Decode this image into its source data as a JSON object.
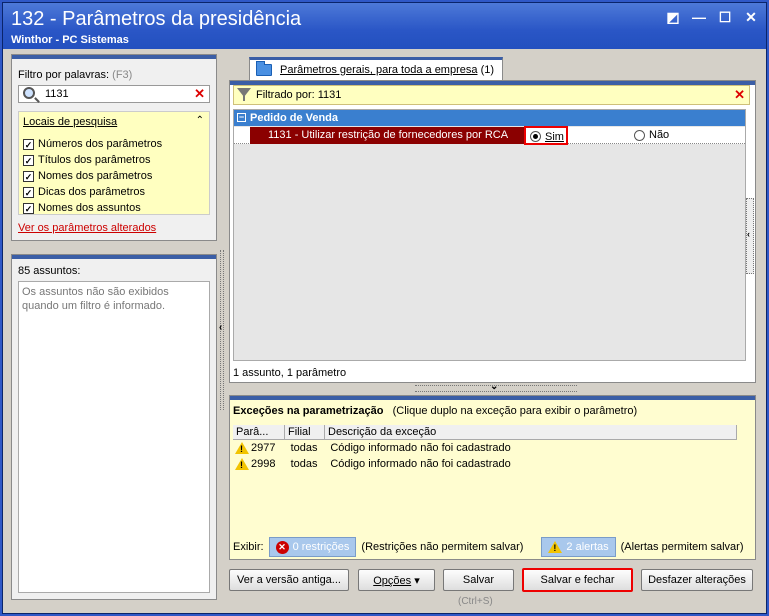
{
  "window": {
    "title": "132 - Parâmetros da presidência",
    "subtitle": "Winthor - PC Sistemas",
    "controls": [
      "◩",
      "—",
      "☐",
      "✕"
    ]
  },
  "filter": {
    "label": "Filtro por palavras:",
    "shortcut": "(F3)",
    "value": "1131",
    "clear": "✕",
    "locais_title": "Locais de pesquisa",
    "collapse_icon": "⌃",
    "options": [
      {
        "label": "Números dos parâmetros",
        "checked": true
      },
      {
        "label": "Títulos dos parâmetros",
        "checked": true
      },
      {
        "label": "Nomes dos parâmetros",
        "checked": true
      },
      {
        "label": "Dicas dos parâmetros",
        "checked": true
      },
      {
        "label": "Nomes dos assuntos",
        "checked": true
      }
    ],
    "altered_link": "Ver os parâmetros alterados"
  },
  "assuntos": {
    "count_label": "85 assuntos:",
    "message": "Os assuntos não são exibidos quando um filtro é informado."
  },
  "tab": {
    "label": "Parâmetros gerais, para toda a empresa",
    "count": "(1)"
  },
  "main": {
    "filter_text": "Filtrado por: 1131",
    "group": "Pedido de Venda",
    "param_name": "1131 - Utilizar restrição de fornecedores por RCA",
    "option_yes": "Sim",
    "option_no": "Não",
    "selected": "Sim",
    "status": "1 assunto, 1 parâmetro"
  },
  "exceptions": {
    "title": "Exceções na parametrização",
    "hint": "(Clique duplo na exceção para exibir o parâmetro)",
    "columns": [
      "Parâ...",
      "Filial",
      "Descrição da exceção"
    ],
    "rows": [
      {
        "param": "2977",
        "filial": "todas",
        "desc": "Código informado não foi cadastrado"
      },
      {
        "param": "2998",
        "filial": "todas",
        "desc": "Código informado não foi cadastrado"
      }
    ],
    "exibir_label": "Exibir:",
    "restricoes_badge": "0 restrições",
    "restricoes_note": "(Restrições não permitem salvar)",
    "alertas_badge": "2 alertas",
    "alertas_note": "(Alertas permitem salvar)"
  },
  "buttons": {
    "old_version": "Ver a versão antiga...",
    "options": "Opções",
    "save": "Salvar",
    "save_shortcut": "(Ctrl+S)",
    "save_close": "Salvar e fechar",
    "undo": "Desfazer alterações"
  }
}
